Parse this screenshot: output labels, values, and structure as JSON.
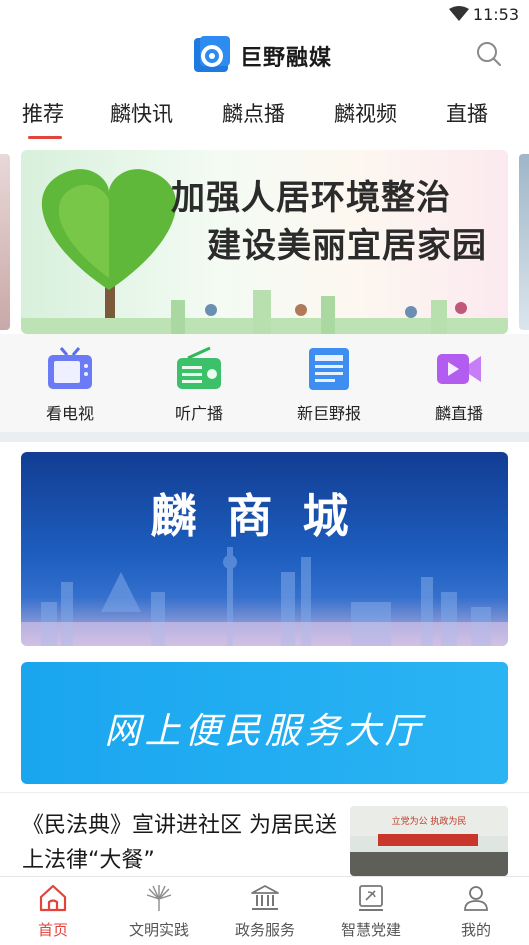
{
  "status_bar": {
    "time": "11:53"
  },
  "app": {
    "title": "巨野融媒",
    "accent": "#e0443a",
    "logo_color": "#1f7ae0"
  },
  "tabs": [
    {
      "label": "推荐",
      "active": true
    },
    {
      "label": "麟快讯"
    },
    {
      "label": "麟点播"
    },
    {
      "label": "麟视频"
    },
    {
      "label": "直播"
    }
  ],
  "banner": {
    "line1": "加强人居环境整治",
    "line2": "建设美丽宜居家园"
  },
  "quick_entries": [
    {
      "label": "看电视",
      "icon": "tv-icon"
    },
    {
      "label": "听广播",
      "icon": "radio-icon"
    },
    {
      "label": "新巨野报",
      "icon": "newspaper-icon"
    },
    {
      "label": "麟直播",
      "icon": "live-video-icon"
    }
  ],
  "mall": {
    "title": "麟商城"
  },
  "service": {
    "title": "网上便民服务大厅"
  },
  "news": {
    "title": "《民法典》宣讲进社区 为居民送上法律“大餐”",
    "thumb_banner": "立党为公  执政为民"
  },
  "bottom_nav": [
    {
      "label": "首页",
      "icon": "home-icon",
      "active": true
    },
    {
      "label": "文明实践",
      "icon": "civilization-icon"
    },
    {
      "label": "政务服务",
      "icon": "government-building-icon"
    },
    {
      "label": "智慧党建",
      "icon": "party-building-icon"
    },
    {
      "label": "我的",
      "icon": "user-icon"
    }
  ]
}
